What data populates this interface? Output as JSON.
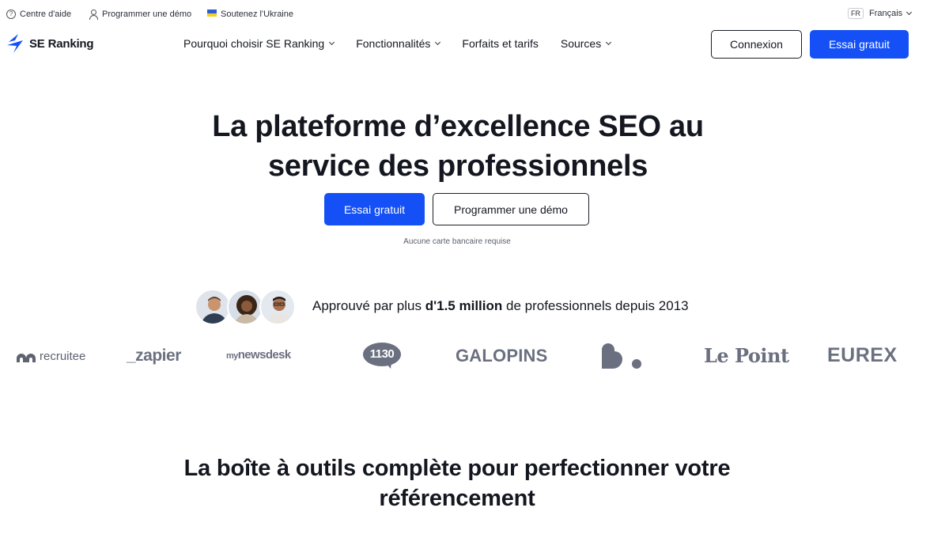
{
  "topbar": {
    "help": "Centre d'aide",
    "demo": "Programmer une démo",
    "ukraine": "Soutenez l'Ukraine",
    "lang_code": "FR",
    "lang_label": "Français"
  },
  "header": {
    "brand": "SE Ranking",
    "nav": {
      "why": "Pourquoi choisir SE Ranking",
      "features": "Fonctionnalités",
      "pricing": "Forfaits et tarifs",
      "sources": "Sources"
    },
    "login": "Connexion",
    "trial": "Essai gratuit"
  },
  "hero": {
    "title_line1": "La plateforme d’excellence SEO au",
    "title_line2": "service des professionnels",
    "cta_primary": "Essai gratuit",
    "cta_secondary": "Programmer une démo",
    "note": "Aucune carte bancaire requise"
  },
  "proof": {
    "prefix": "Approuvé par plus ",
    "highlight": "d'1.5 million",
    "suffix": " de professionnels depuis 2013"
  },
  "logos": {
    "recruitee": "recruitee",
    "zapier": "_zapier",
    "mynewsdesk_a": "my",
    "mynewsdesk_b": "newsdesk",
    "n1130": "1130",
    "galopins": "GALOPINS",
    "lepoint": "Le Point",
    "eurex": "EUREX"
  },
  "section": {
    "title_line1": "La boîte à outils complète pour perfectionner votre",
    "title_line2": "référencement"
  },
  "colors": {
    "primary": "#1450f5",
    "text": "#14171f",
    "logo_gray": "#6b7080"
  }
}
